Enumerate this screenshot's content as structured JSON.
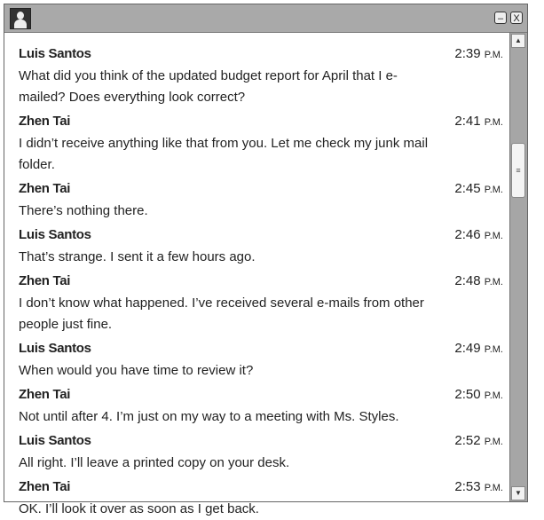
{
  "window": {
    "avatar_icon": "user-silhouette-icon",
    "minimize_label": "–",
    "close_label": "X"
  },
  "messages": [
    {
      "name": "Luis Santos",
      "time": "2:39",
      "ampm": "P.M.",
      "text": "What did you think of the updated budget report for April that I e-mailed? Does everything look correct?"
    },
    {
      "name": "Zhen Tai",
      "time": "2:41",
      "ampm": "P.M.",
      "text": "I didn’t receive anything like that from you. Let me check my junk mail folder."
    },
    {
      "name": "Zhen Tai",
      "time": "2:45",
      "ampm": "P.M.",
      "text": "There’s nothing there."
    },
    {
      "name": "Luis Santos",
      "time": "2:46",
      "ampm": "P.M.",
      "text": "That’s strange. I sent it a few hours ago."
    },
    {
      "name": "Zhen Tai",
      "time": "2:48",
      "ampm": "P.M.",
      "text": "I don’t know what happened. I’ve received several e-mails from other people just fine."
    },
    {
      "name": "Luis Santos",
      "time": "2:49",
      "ampm": "P.M.",
      "text": "When would you have time to review it?"
    },
    {
      "name": "Zhen Tai",
      "time": "2:50",
      "ampm": "P.M.",
      "text": "Not until after 4. I’m just on my way to a meeting with Ms. Styles."
    },
    {
      "name": "Luis Santos",
      "time": "2:52",
      "ampm": "P.M.",
      "text": "All right. I’ll leave a printed copy on your desk."
    },
    {
      "name": "Zhen Tai",
      "time": "2:53",
      "ampm": "P.M.",
      "text": "OK. I’ll look it over as soon as I get back."
    }
  ]
}
